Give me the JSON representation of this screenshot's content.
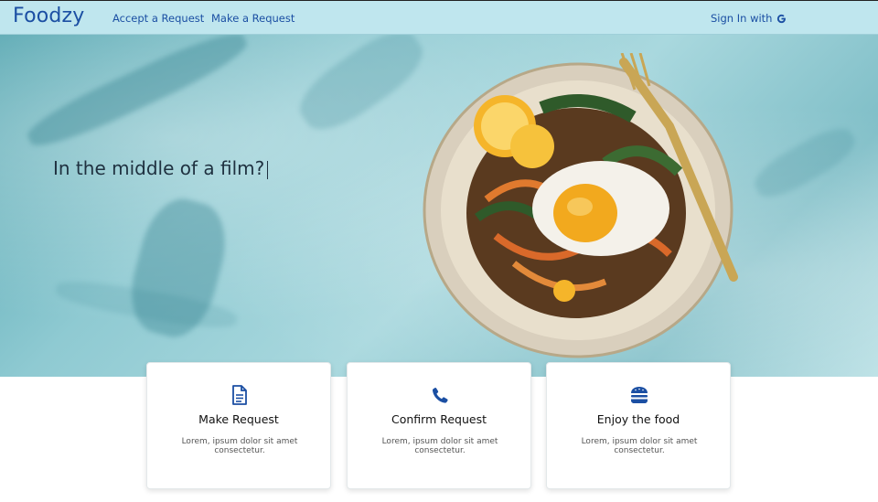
{
  "header": {
    "brand": "Foodzy",
    "nav": [
      {
        "label": "Accept a Request"
      },
      {
        "label": "Make a Request"
      }
    ],
    "signin_label": "Sign In with"
  },
  "hero": {
    "tagline": "In the middle of a film?"
  },
  "cards": [
    {
      "icon": "document-icon",
      "title": "Make Request",
      "text": "Lorem, ipsum dolor sit amet consectetur."
    },
    {
      "icon": "phone-icon",
      "title": "Confirm Request",
      "text": "Lorem, ipsum dolor sit amet consectetur."
    },
    {
      "icon": "burger-icon",
      "title": "Enjoy the food",
      "text": "Lorem, ipsum dolor sit amet consectetur."
    }
  ],
  "colors": {
    "navbar_bg": "#bfe6ee",
    "accent": "#1b4fa3"
  }
}
